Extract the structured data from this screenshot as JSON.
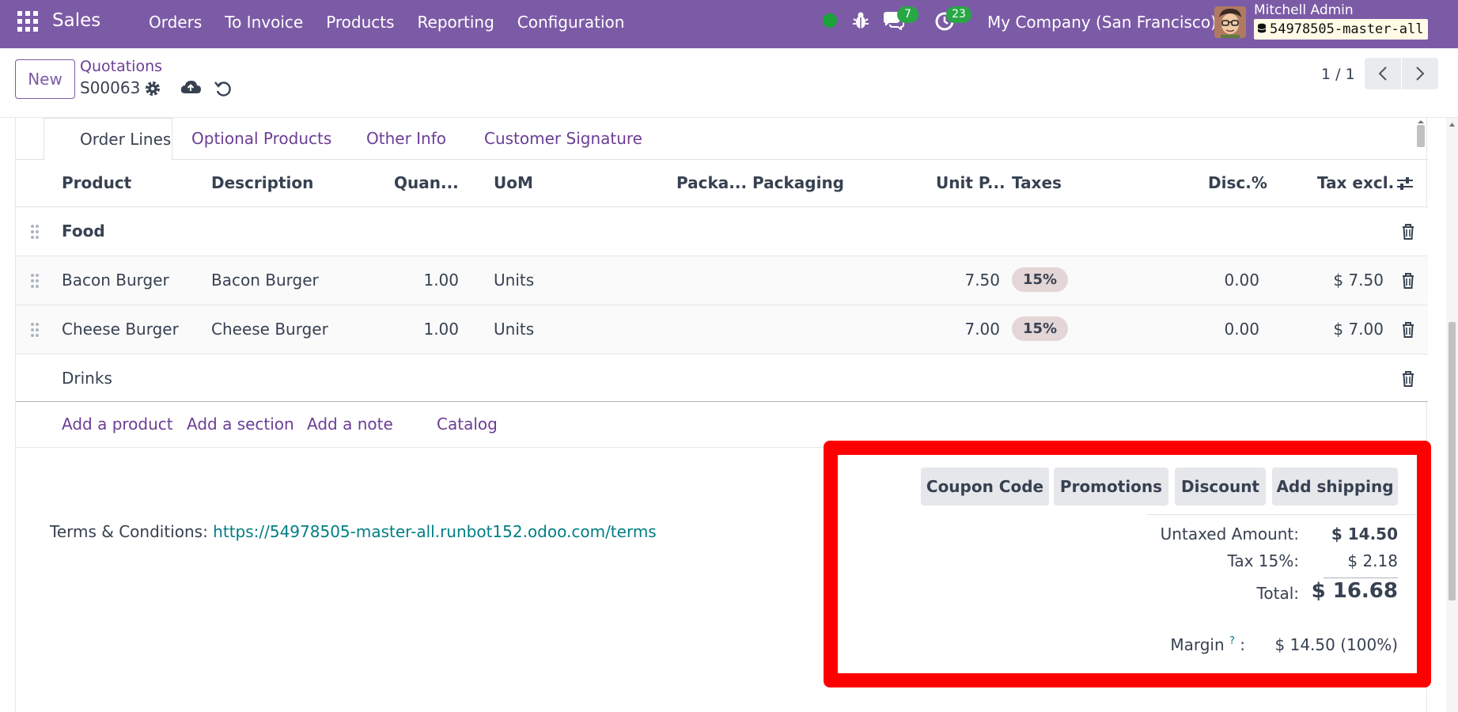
{
  "navbar": {
    "brand": "Sales",
    "menu": [
      "Orders",
      "To Invoice",
      "Products",
      "Reporting",
      "Configuration"
    ],
    "chat_count": "7",
    "activity_count": "23",
    "company": "My Company (San Francisco)",
    "user_name": "Mitchell Admin",
    "database": "54978505-master-all",
    "accent_color": "#7c5ba6"
  },
  "control": {
    "new_label": "New",
    "breadcrumb": "Quotations",
    "record_name": "S00063",
    "pager": "1 / 1"
  },
  "tabs": [
    "Order Lines",
    "Optional Products",
    "Other Info",
    "Customer Signature"
  ],
  "table": {
    "headers": {
      "product": "Product",
      "description": "Description",
      "quantity": "Quan...",
      "uom": "UoM",
      "packaging_qty": "Packa...",
      "packaging": "Packaging",
      "unit_price": "Unit P...",
      "taxes": "Taxes",
      "discount": "Disc.%",
      "subtotal": "Tax excl."
    },
    "section_food": "Food",
    "lines": [
      {
        "product": "Bacon Burger",
        "description": "Bacon Burger",
        "quantity": "1.00",
        "uom": "Units",
        "unit_price": "7.50",
        "tax": "15%",
        "discount": "0.00",
        "subtotal": "$ 7.50"
      },
      {
        "product": "Cheese Burger",
        "description": "Cheese Burger",
        "quantity": "1.00",
        "uom": "Units",
        "unit_price": "7.00",
        "tax": "15%",
        "discount": "0.00",
        "subtotal": "$ 7.00"
      }
    ],
    "section_drinks": "Drinks",
    "add_product": "Add a product",
    "add_section": "Add a section",
    "add_note": "Add a note",
    "catalog": "Catalog"
  },
  "terms": {
    "label": "Terms & Conditions:",
    "link": "https://54978505-master-all.runbot152.odoo.com/terms"
  },
  "totals": {
    "buttons": [
      "Coupon Code",
      "Promotions",
      "Discount",
      "Add shipping"
    ],
    "untaxed_label": "Untaxed Amount:",
    "untaxed_value": "$ 14.50",
    "tax_label": "Tax 15%:",
    "tax_value": "$ 2.18",
    "total_label": "Total:",
    "total_value": "$ 16.68",
    "margin_label": "Margin",
    "margin_help": "?",
    "margin_value": "$ 14.50 (100%)",
    "highlight_color": "#ff0000"
  }
}
